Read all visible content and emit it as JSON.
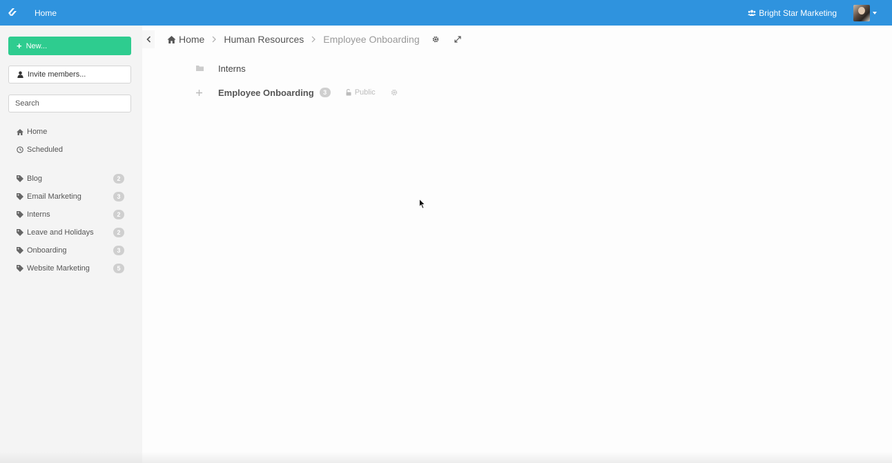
{
  "topbar": {
    "home_label": "Home",
    "team_name": "Bright Star Marketing",
    "logo_icon": "stack-logo-icon",
    "bg_color": "#2f93de"
  },
  "sidebar": {
    "new_button": "New...",
    "invite_button": "Invite members...",
    "search_placeholder": "Search",
    "nav": [
      {
        "label": "Home",
        "icon": "home-icon"
      },
      {
        "label": "Scheduled",
        "icon": "clock-icon"
      }
    ],
    "tags": [
      {
        "label": "Blog",
        "count": "2"
      },
      {
        "label": "Email Marketing",
        "count": "3"
      },
      {
        "label": "Interns",
        "count": "2"
      },
      {
        "label": "Leave and Holidays",
        "count": "2"
      },
      {
        "label": "Onboarding",
        "count": "3"
      },
      {
        "label": "Website Marketing",
        "count": "5"
      }
    ],
    "accent_color": "#2ecc8f"
  },
  "breadcrumb": {
    "items": [
      "Home",
      "Human Resources",
      "Employee Onboarding"
    ]
  },
  "content": {
    "rows": [
      {
        "title": "Interns",
        "icon": "folder-icon"
      },
      {
        "title": "Employee Onboarding",
        "icon": "plus-icon",
        "count": "3",
        "visibility": "Public"
      }
    ]
  }
}
